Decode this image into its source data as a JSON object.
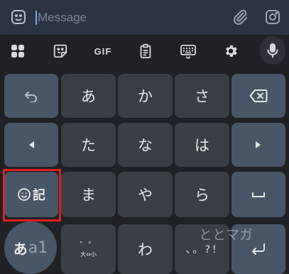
{
  "message_bar": {
    "placeholder": "Message",
    "left_icon": "sticker-icon",
    "attach_icon": "paperclip-icon",
    "camera_icon": "instagram-camera-icon"
  },
  "toolbar": {
    "items": [
      "apps-grid-icon",
      "sticker-icon",
      "gif",
      "clipboard-icon",
      "keyboard-icon",
      "settings-gear-icon",
      "microphone-icon"
    ],
    "gif_label": "GIF"
  },
  "keys": {
    "row1": [
      "あ",
      "か",
      "さ"
    ],
    "row2": [
      "た",
      "な",
      "は"
    ],
    "row3": [
      "ま",
      "や",
      "ら"
    ],
    "row4_center": "わ",
    "emoji_label": "記",
    "kana_mode_main": "あ",
    "kana_mode_sub": "a1",
    "small_kana_top": "゛゜",
    "small_kana_bottom": "大⇔小",
    "punctuation": "、。?!"
  },
  "watermark": "ととマガ"
}
